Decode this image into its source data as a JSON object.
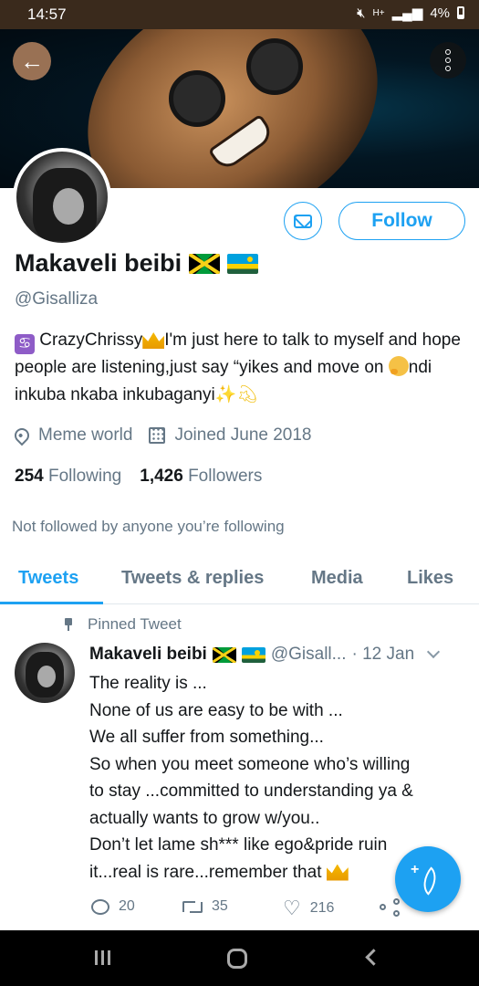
{
  "status_bar": {
    "time": "14:57",
    "network": "H+",
    "battery": "4%"
  },
  "profile": {
    "display_name": "Makaveli beibi",
    "handle": "@Gisalliza",
    "follow_label": "Follow",
    "bio": {
      "zodiac": "♋",
      "line_a": "CrazyChrissy",
      "line_b": "I'm just here to talk to myself and hope people are listening,just say “yikes and move on ",
      "line_c": "ndi inkuba nkaba inkubaganyi"
    },
    "location": "Meme world",
    "joined": "Joined June 2018",
    "following_count": "254",
    "following_label": "Following",
    "followers_count": "1,426",
    "followers_label": "Followers",
    "not_followed_note": "Not followed by anyone you’re following"
  },
  "tabs": [
    {
      "label": "Tweets",
      "active": true
    },
    {
      "label": "Tweets & replies",
      "active": false
    },
    {
      "label": "Media",
      "active": false
    },
    {
      "label": "Likes",
      "active": false
    }
  ],
  "pinned_tweet": {
    "pinned_label": "Pinned Tweet",
    "author_name": "Makaveli beibi",
    "author_handle": "@Gisall...",
    "date": "· 12 Jan",
    "lines": [
      "The reality is ...",
      "None of us are easy to be with ...",
      "We all suffer from something...",
      "So when you meet someone who’s willing",
      "to stay ...committed to understanding ya &",
      "actually wants to grow w/you..",
      "Don’t let lame sh*** like ego&pride ruin",
      "it...real is rare...remember that "
    ],
    "replies": "20",
    "retweets": "35",
    "likes": "216"
  },
  "colors": {
    "accent": "#1da1f2",
    "secondary_text": "#657786",
    "status_bar": "#3a2a1c"
  },
  "icons": [
    "back-arrow-icon",
    "more-vertical-icon",
    "message-icon",
    "location-pin-icon",
    "calendar-icon",
    "pin-icon",
    "reply-icon",
    "retweet-icon",
    "heart-icon",
    "share-icon",
    "feather-icon"
  ]
}
